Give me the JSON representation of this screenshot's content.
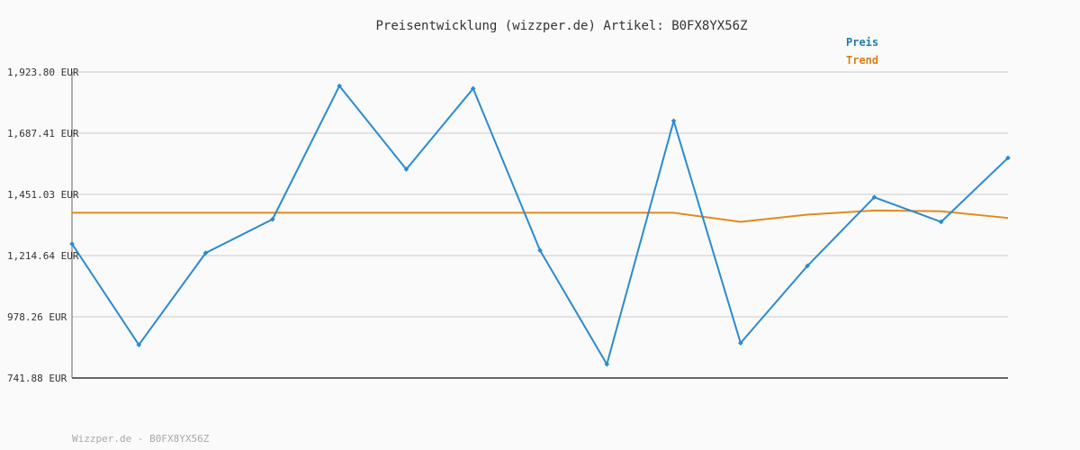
{
  "chart_data": {
    "type": "line",
    "title": "Preisentwicklung (wizzper.de) Artikel: B0FX8YX56Z",
    "xlabel": "",
    "ylabel": "",
    "ylim": [
      741.88,
      1923.8
    ],
    "y_ticks": [
      "1,923.80 EUR",
      "1,687.41 EUR",
      "1,451.03 EUR",
      "1,214.64 EUR",
      "978.26 EUR",
      "741.88 EUR"
    ],
    "y_tick_values": [
      1923.8,
      1687.41,
      1451.03,
      1214.64,
      978.26,
      741.88
    ],
    "x": [
      0,
      1,
      2,
      3,
      4,
      5,
      6,
      7,
      8,
      9,
      10,
      11,
      12,
      13,
      14
    ],
    "grid": true,
    "legend": "top-right",
    "series": [
      {
        "name": "Preis",
        "color": "#2a8bd0",
        "values": [
          1260,
          870,
          1225,
          1355,
          1870,
          1548,
          1860,
          1235,
          795,
          1735,
          877,
          1175,
          1440,
          1345,
          1592
        ]
      },
      {
        "name": "Trend",
        "color": "#e08a1e",
        "values": [
          1380,
          1380,
          1380,
          1380,
          1380,
          1380,
          1380,
          1380,
          1380,
          1380,
          1345,
          1373,
          1389,
          1386,
          1360
        ]
      }
    ]
  },
  "footer": {
    "text": "Wizzper.de - B0FX8YX56Z"
  },
  "colors": {
    "background": "#fafafa",
    "grid": "#e2e2e2",
    "axis": "#666666",
    "preis_legend": "#1f7bb0",
    "trend_legend": "#d87f17"
  }
}
